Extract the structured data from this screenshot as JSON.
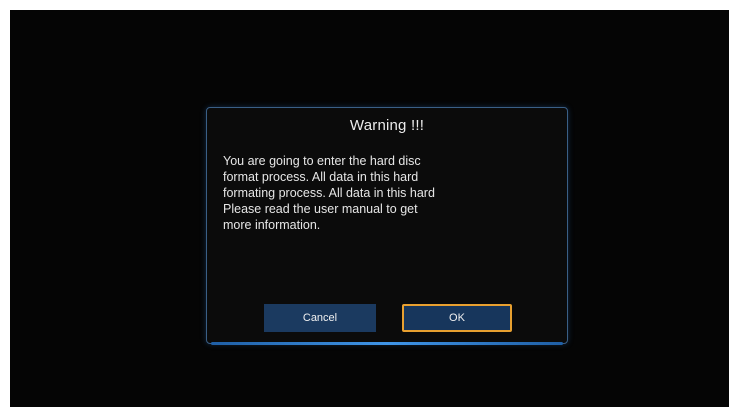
{
  "dialog": {
    "title": "Warning !!!",
    "message_lines": [
      "You are going to enter the hard disc",
      "format process. All data in this hard",
      "formating process. All data in this hard",
      "Please read the user manual to get",
      "more information."
    ],
    "buttons": {
      "cancel_label": "Cancel",
      "ok_label": "OK",
      "focused": "ok"
    }
  },
  "colors": {
    "screen_background": "#050505",
    "dialog_border": "#3a5f86",
    "button_fill": "#1b3a60",
    "focus_outline": "#e8a030"
  }
}
